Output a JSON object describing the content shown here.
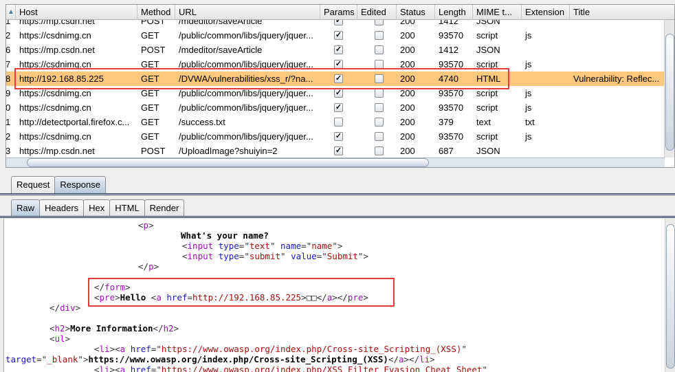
{
  "table": {
    "columns": [
      "",
      "Host",
      "Method",
      "URL",
      "Params",
      "Edited",
      "Status",
      "Length",
      "MIME t...",
      "Extension",
      "Title"
    ],
    "rows": [
      {
        "num": "1",
        "host": "https://mp.csdn.net",
        "method": "POST",
        "url": "/mdeditor/saveArticle",
        "params": true,
        "edited": false,
        "status": "200",
        "length": "1412",
        "mime": "JSON",
        "ext": "",
        "title": ""
      },
      {
        "num": "2",
        "host": "https://csdnimg.cn",
        "method": "GET",
        "url": "/public/common/libs/jquery/jquer...",
        "params": true,
        "edited": false,
        "status": "200",
        "length": "93570",
        "mime": "script",
        "ext": "js",
        "title": ""
      },
      {
        "num": "6",
        "host": "https://mp.csdn.net",
        "method": "POST",
        "url": "/mdeditor/saveArticle",
        "params": true,
        "edited": false,
        "status": "200",
        "length": "1412",
        "mime": "JSON",
        "ext": "",
        "title": ""
      },
      {
        "num": "7",
        "host": "https://csdnimg.cn",
        "method": "GET",
        "url": "/public/common/libs/jquery/jquer...",
        "params": true,
        "edited": false,
        "status": "200",
        "length": "93570",
        "mime": "script",
        "ext": "js",
        "title": ""
      },
      {
        "num": "8",
        "host": "http://192.168.85.225",
        "method": "GET",
        "url": "/DVWA/vulnerabilities/xss_r/?na...",
        "params": true,
        "edited": false,
        "status": "200",
        "length": "4740",
        "mime": "HTML",
        "ext": "",
        "title": "Vulnerability: Reflec...",
        "selected": true
      },
      {
        "num": "9",
        "host": "https://csdnimg.cn",
        "method": "GET",
        "url": "/public/common/libs/jquery/jquer...",
        "params": true,
        "edited": false,
        "status": "200",
        "length": "93570",
        "mime": "script",
        "ext": "js",
        "title": ""
      },
      {
        "num": "0",
        "host": "https://csdnimg.cn",
        "method": "GET",
        "url": "/public/common/libs/jquery/jquer...",
        "params": true,
        "edited": false,
        "status": "200",
        "length": "93570",
        "mime": "script",
        "ext": "js",
        "title": ""
      },
      {
        "num": "1",
        "host": "http://detectportal.firefox.c...",
        "method": "GET",
        "url": "/success.txt",
        "params": false,
        "edited": false,
        "status": "200",
        "length": "379",
        "mime": "text",
        "ext": "txt",
        "title": ""
      },
      {
        "num": "2",
        "host": "https://csdnimg.cn",
        "method": "GET",
        "url": "/public/common/libs/jquery/jquer...",
        "params": true,
        "edited": false,
        "status": "200",
        "length": "93570",
        "mime": "script",
        "ext": "js",
        "title": ""
      },
      {
        "num": "3",
        "host": "https://mp.csdn.net",
        "method": "POST",
        "url": "/UploadImage?shuiyin=2",
        "params": true,
        "edited": false,
        "status": "200",
        "length": "687",
        "mime": "JSON",
        "ext": "",
        "title": ""
      }
    ]
  },
  "message_tabs": [
    {
      "label": "Request"
    },
    {
      "label": "Response",
      "active": true
    }
  ],
  "view_tabs": [
    {
      "label": "Raw",
      "active": true
    },
    {
      "label": "Headers"
    },
    {
      "label": "Hex"
    },
    {
      "label": "HTML"
    },
    {
      "label": "Render"
    }
  ],
  "highlight_color": "#ffc87c",
  "code_lines": [
    [
      [
        "b",
        "<"
      ],
      [
        "t",
        "p"
      ],
      [
        "b",
        ">"
      ]
    ],
    [
      [
        "x",
        "What's your name?"
      ]
    ],
    [
      [
        "b",
        "<"
      ],
      [
        "t",
        "input "
      ],
      [
        "a",
        "type"
      ],
      [
        "b",
        "=\""
      ],
      [
        "v",
        "text"
      ],
      [
        "b",
        "\" "
      ],
      [
        "a",
        "name"
      ],
      [
        "b",
        "=\""
      ],
      [
        "v",
        "name"
      ],
      [
        "b",
        "\">"
      ]
    ],
    [
      [
        "b",
        "<"
      ],
      [
        "t",
        "input "
      ],
      [
        "a",
        "type"
      ],
      [
        "b",
        "=\""
      ],
      [
        "v",
        "submit"
      ],
      [
        "b",
        "\" "
      ],
      [
        "a",
        "value"
      ],
      [
        "b",
        "=\""
      ],
      [
        "v",
        "Submit"
      ],
      [
        "b",
        "\">"
      ]
    ],
    [
      [
        "b",
        "</"
      ],
      [
        "t",
        "p"
      ],
      [
        "b",
        ">"
      ]
    ],
    [],
    [
      [
        "b",
        "</"
      ],
      [
        "t",
        "form"
      ],
      [
        "b",
        ">"
      ]
    ],
    [
      [
        "b",
        "<"
      ],
      [
        "t",
        "pre"
      ],
      [
        "b",
        ">"
      ],
      [
        "x",
        "Hello "
      ],
      [
        "b",
        "<"
      ],
      [
        "t",
        "a "
      ],
      [
        "a",
        "href"
      ],
      [
        "b",
        "="
      ],
      [
        "v",
        "http://192.168.85.225"
      ],
      [
        "b",
        ">□□</"
      ],
      [
        "t",
        "a"
      ],
      [
        "b",
        "></"
      ],
      [
        "t",
        "pre"
      ],
      [
        "b",
        ">"
      ]
    ],
    [
      [
        "b",
        "</"
      ],
      [
        "t",
        "div"
      ],
      [
        "b",
        ">"
      ]
    ],
    [],
    [
      [
        "b",
        "<"
      ],
      [
        "t",
        "h2"
      ],
      [
        "b",
        ">"
      ],
      [
        "x",
        "More Information"
      ],
      [
        "b",
        "</"
      ],
      [
        "t",
        "h2"
      ],
      [
        "b",
        ">"
      ]
    ],
    [
      [
        "b",
        "<"
      ],
      [
        "t",
        "ul"
      ],
      [
        "b",
        ">"
      ]
    ],
    [
      [
        "b",
        "<"
      ],
      [
        "t",
        "li"
      ],
      [
        "b",
        "><"
      ],
      [
        "t",
        "a "
      ],
      [
        "a",
        "href"
      ],
      [
        "b",
        "=\""
      ],
      [
        "v",
        "https://www.owasp.org/index.php/Cross-site_Scripting_(XSS)"
      ],
      [
        "b",
        "\""
      ]
    ],
    [
      [
        "a",
        "target"
      ],
      [
        "b",
        "=\""
      ],
      [
        "v",
        "_blank"
      ],
      [
        "b",
        "\">"
      ],
      [
        "x",
        "https://www.owasp.org/index.php/Cross-site_Scripting_(XSS)"
      ],
      [
        "b",
        "</"
      ],
      [
        "t",
        "a"
      ],
      [
        "b",
        "></"
      ],
      [
        "t",
        "li"
      ],
      [
        "b",
        ">"
      ]
    ],
    [
      [
        "b",
        "<"
      ],
      [
        "t",
        "li"
      ],
      [
        "b",
        "><"
      ],
      [
        "t",
        "a "
      ],
      [
        "a",
        "href"
      ],
      [
        "b",
        "=\""
      ],
      [
        "v",
        "https://www.owasp.org/index.php/XSS_Filter_Evasion_Cheat_Sheet"
      ],
      [
        "b",
        "\""
      ]
    ]
  ]
}
